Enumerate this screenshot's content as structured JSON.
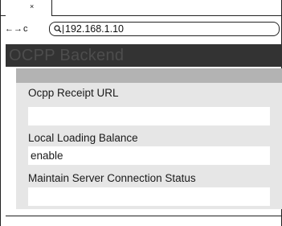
{
  "browser": {
    "tab": {
      "close_glyph": "×"
    },
    "nav": {
      "back": "←",
      "forward": "→",
      "reload": "c"
    },
    "address": {
      "icon": "search-icon",
      "url": "192.168.1.10"
    }
  },
  "app": {
    "title": "OCPP Backend",
    "colors": {
      "header_bg": "#333333",
      "title": "#4d4d4d",
      "panel_bg": "#e6e6e6",
      "band": "#b3b3b3"
    }
  },
  "form": {
    "fields": [
      {
        "label": "Ocpp Receipt URL",
        "value": ""
      },
      {
        "label": "Local Loading Balance",
        "value": "enable"
      },
      {
        "label": "Maintain Server Connection Status",
        "value": ""
      }
    ]
  }
}
